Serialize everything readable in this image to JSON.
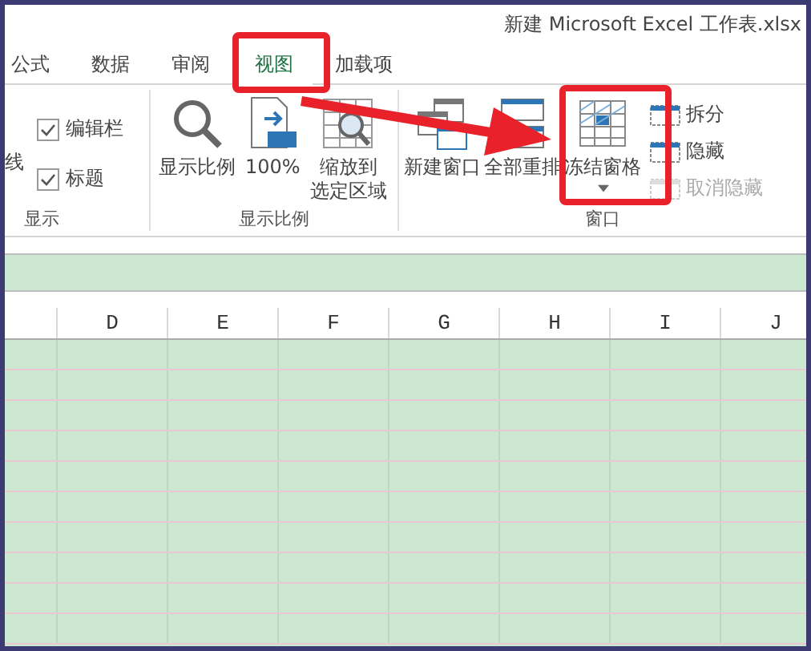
{
  "window": {
    "title": "新建 Microsoft Excel 工作表.xlsx"
  },
  "tabs": [
    {
      "label": "公式",
      "selected": false
    },
    {
      "label": "数据",
      "selected": false
    },
    {
      "label": "审阅",
      "selected": false
    },
    {
      "label": "视图",
      "selected": true
    },
    {
      "label": "加载项",
      "selected": false
    }
  ],
  "display_group": {
    "label": "显示",
    "cut_items": [
      "线"
    ],
    "checkboxes": [
      {
        "label": "编辑栏",
        "checked": true
      },
      {
        "label": "标题",
        "checked": true
      }
    ]
  },
  "zoom_group": {
    "label": "显示比例",
    "buttons": [
      {
        "label": "显示比例",
        "kind": "zoom"
      },
      {
        "label": "100%",
        "kind": "hundred"
      },
      {
        "lines": [
          "缩放到",
          "选定区域"
        ],
        "kind": "selection"
      }
    ]
  },
  "window_group": {
    "label": "窗口",
    "buttons": [
      {
        "label": "新建窗口",
        "kind": "new-window",
        "dropdown": false
      },
      {
        "label": "全部重排",
        "kind": "arrange",
        "dropdown": false
      },
      {
        "label": "冻结窗格",
        "kind": "freeze",
        "dropdown": true
      }
    ],
    "small_buttons": [
      {
        "label": "拆分",
        "disabled": false
      },
      {
        "label": "隐藏",
        "disabled": false
      },
      {
        "label": "取消隐藏",
        "disabled": true
      }
    ]
  },
  "sheet": {
    "columns": [
      "D",
      "E",
      "F",
      "G",
      "H",
      "I",
      "J"
    ]
  }
}
